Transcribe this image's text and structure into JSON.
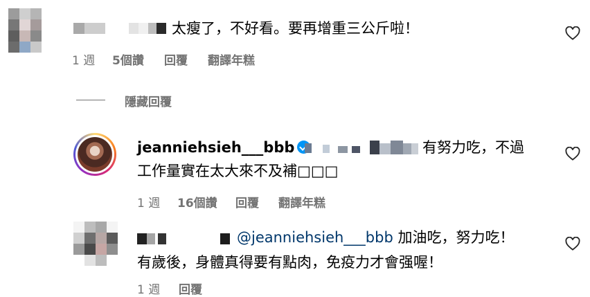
{
  "comments": [
    {
      "text": "太瘦了，不好看。要再增重三公斤啦！",
      "meta": {
        "time": "1 週",
        "likes": "5個讚",
        "reply": "回覆",
        "translate": "翻譯年糕"
      }
    },
    {
      "hide_replies": "隱藏回覆",
      "username": "jeanniehsieh___bbb",
      "text_line1": "有努力吃，不過",
      "text_line2": "工作量實在太大來不及補□□□",
      "meta": {
        "time": "1 週",
        "likes": "16個讚",
        "reply": "回覆",
        "translate": "翻譯年糕"
      }
    },
    {
      "mention": "@jeanniehsieh___bbb",
      "text_line1": "加油吃，努力吃！",
      "text_line2": "有歲後，身體真得要有點肉，免疫力才會强喔！",
      "meta": {
        "time": "1 週",
        "likes": "",
        "reply": "回覆",
        "translate": ""
      }
    }
  ],
  "icons": {
    "like": "heart-outline-icon",
    "verified": "verified-badge-icon"
  },
  "colors": {
    "verified": "#0095f6",
    "meta_text": "#737373",
    "mention": "#00376b"
  }
}
